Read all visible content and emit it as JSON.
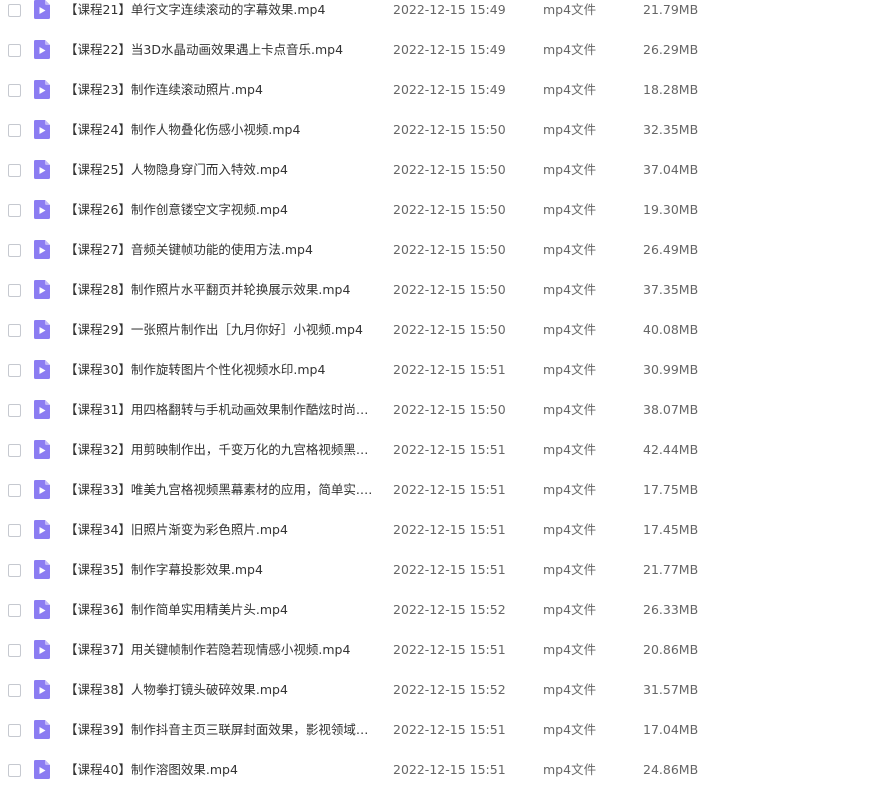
{
  "file_type_label": "mp4文件",
  "icon_color": "#8b7cf2",
  "files": [
    {
      "name": "【课程21】单行文字连续滚动的字幕效果.mp4",
      "date": "2022-12-15 15:49",
      "size": "21.79MB"
    },
    {
      "name": "【课程22】当3D水晶动画效果遇上卡点音乐.mp4",
      "date": "2022-12-15 15:49",
      "size": "26.29MB"
    },
    {
      "name": "【课程23】制作连续滚动照片.mp4",
      "date": "2022-12-15 15:49",
      "size": "18.28MB"
    },
    {
      "name": "【课程24】制作人物叠化伤感小视频.mp4",
      "date": "2022-12-15 15:50",
      "size": "32.35MB"
    },
    {
      "name": "【课程25】人物隐身穿门而入特效.mp4",
      "date": "2022-12-15 15:50",
      "size": "37.04MB"
    },
    {
      "name": "【课程26】制作创意镂空文字视频.mp4",
      "date": "2022-12-15 15:50",
      "size": "19.30MB"
    },
    {
      "name": "【课程27】音频关键帧功能的使用方法.mp4",
      "date": "2022-12-15 15:50",
      "size": "26.49MB"
    },
    {
      "name": "【课程28】制作照片水平翻页并轮换展示效果.mp4",
      "date": "2022-12-15 15:50",
      "size": "37.35MB"
    },
    {
      "name": "【课程29】一张照片制作出［九月你好］小视频.mp4",
      "date": "2022-12-15 15:50",
      "size": "40.08MB"
    },
    {
      "name": "【课程30】制作旋转图片个性化视频水印.mp4",
      "date": "2022-12-15 15:51",
      "size": "30.99MB"
    },
    {
      "name": "【课程31】用四格翻转与手机动画效果制作酷炫时尚视频...",
      "date": "2022-12-15 15:50",
      "size": "38.07MB"
    },
    {
      "name": "【课程32】用剪映制作出，千变万化的九宫格视频黑幕素...",
      "date": "2022-12-15 15:51",
      "size": "42.44MB"
    },
    {
      "name": "【课程33】唯美九宫格视频黑幕素材的应用，简单实.mp4",
      "date": "2022-12-15 15:51",
      "size": "17.75MB"
    },
    {
      "name": "【课程34】旧照片渐变为彩色照片.mp4",
      "date": "2022-12-15 15:51",
      "size": "17.45MB"
    },
    {
      "name": "【课程35】制作字幕投影效果.mp4",
      "date": "2022-12-15 15:51",
      "size": "21.77MB"
    },
    {
      "name": "【课程36】制作简单实用精美片头.mp4",
      "date": "2022-12-15 15:52",
      "size": "26.33MB"
    },
    {
      "name": "【课程37】用关键帧制作若隐若现情感小视频.mp4",
      "date": "2022-12-15 15:51",
      "size": "20.86MB"
    },
    {
      "name": "【课程38】人物拳打镜头破碎效果.mp4",
      "date": "2022-12-15 15:52",
      "size": "31.57MB"
    },
    {
      "name": "【课程39】制作抖音主页三联屏封面效果，影视领域作者...",
      "date": "2022-12-15 15:51",
      "size": "17.04MB"
    },
    {
      "name": "【课程40】制作溶图效果.mp4",
      "date": "2022-12-15 15:51",
      "size": "24.86MB"
    }
  ]
}
